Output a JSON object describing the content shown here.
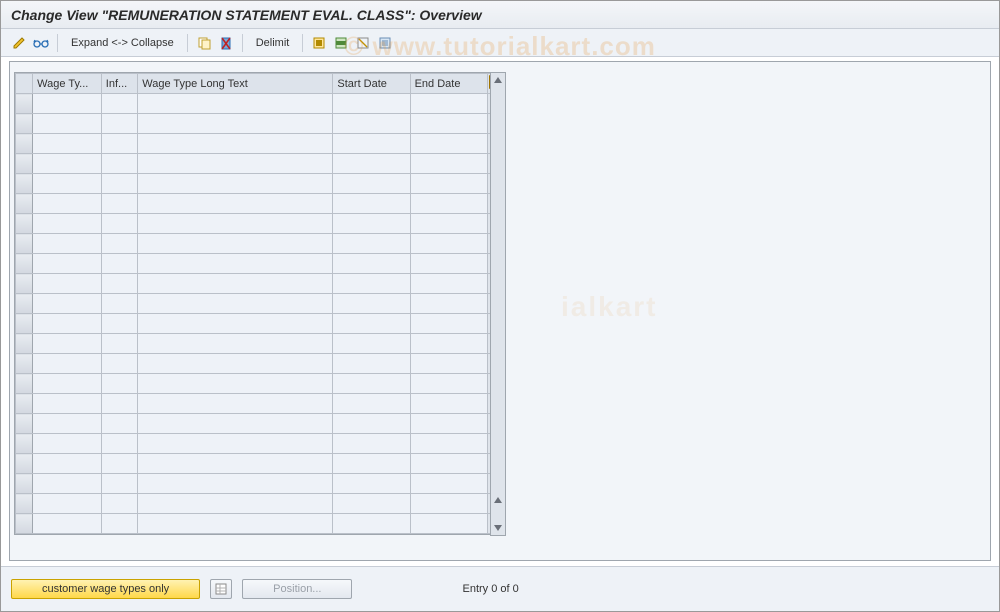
{
  "header": {
    "title": "Change View \"REMUNERATION STATEMENT EVAL. CLASS\": Overview"
  },
  "toolbar": {
    "expand_collapse": "Expand <-> Collapse",
    "delimit": "Delimit"
  },
  "table": {
    "columns": [
      "Wage Ty...",
      "Inf...",
      "Wage Type Long Text",
      "Start Date",
      "End Date"
    ],
    "row_count": 22
  },
  "footer": {
    "customer_wage_types": "customer wage types only",
    "position": "Position...",
    "entry": "Entry 0 of 0"
  },
  "watermark": {
    "a": "© www.tutorialkart.com",
    "b": "ialkart"
  }
}
